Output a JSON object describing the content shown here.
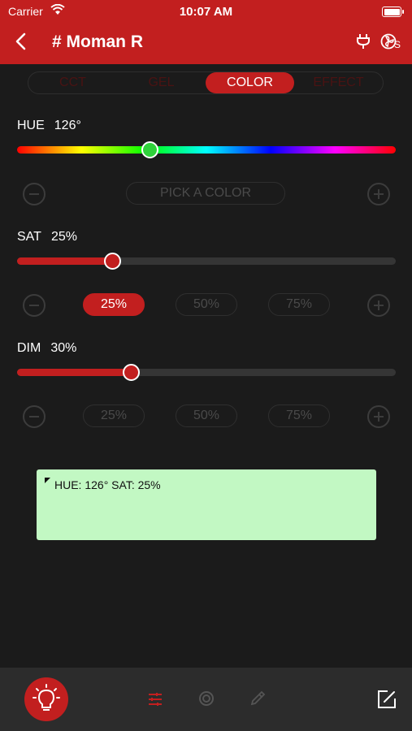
{
  "status": {
    "carrier": "Carrier",
    "time": "10:07 AM"
  },
  "header": {
    "title": "# Moman R",
    "back_icon": "chevron-left-icon",
    "plug_icon": "plug-icon",
    "fan_icon": "fan-s-icon",
    "fan_badge": "S"
  },
  "tabs": [
    {
      "label": "CCT",
      "active": false
    },
    {
      "label": "GEL",
      "active": false
    },
    {
      "label": "COLOR",
      "active": true
    },
    {
      "label": "EFFECT",
      "active": false
    }
  ],
  "hue": {
    "label": "HUE",
    "value_text": "126°",
    "value": 126,
    "max": 360,
    "pick_label": "PICK A COLOR"
  },
  "sat": {
    "label": "SAT",
    "value_text": "25%",
    "value": 25,
    "presets": [
      "25%",
      "50%",
      "75%"
    ],
    "active_preset": 0
  },
  "dim": {
    "label": "DIM",
    "value_text": "30%",
    "value": 30,
    "presets": [
      "25%",
      "50%",
      "75%"
    ],
    "active_preset": -1
  },
  "preview": {
    "text": "HUE: 126° SAT: 25%",
    "color": "#c2f8c3"
  },
  "bottom": {
    "bulb_icon": "lightbulb-icon",
    "sliders_icon": "sliders-icon",
    "target_icon": "target-icon",
    "eyedropper_icon": "eyedropper-icon",
    "edit_icon": "edit-icon"
  },
  "colors": {
    "accent": "#c21f1f",
    "background": "#1b1b1b"
  }
}
